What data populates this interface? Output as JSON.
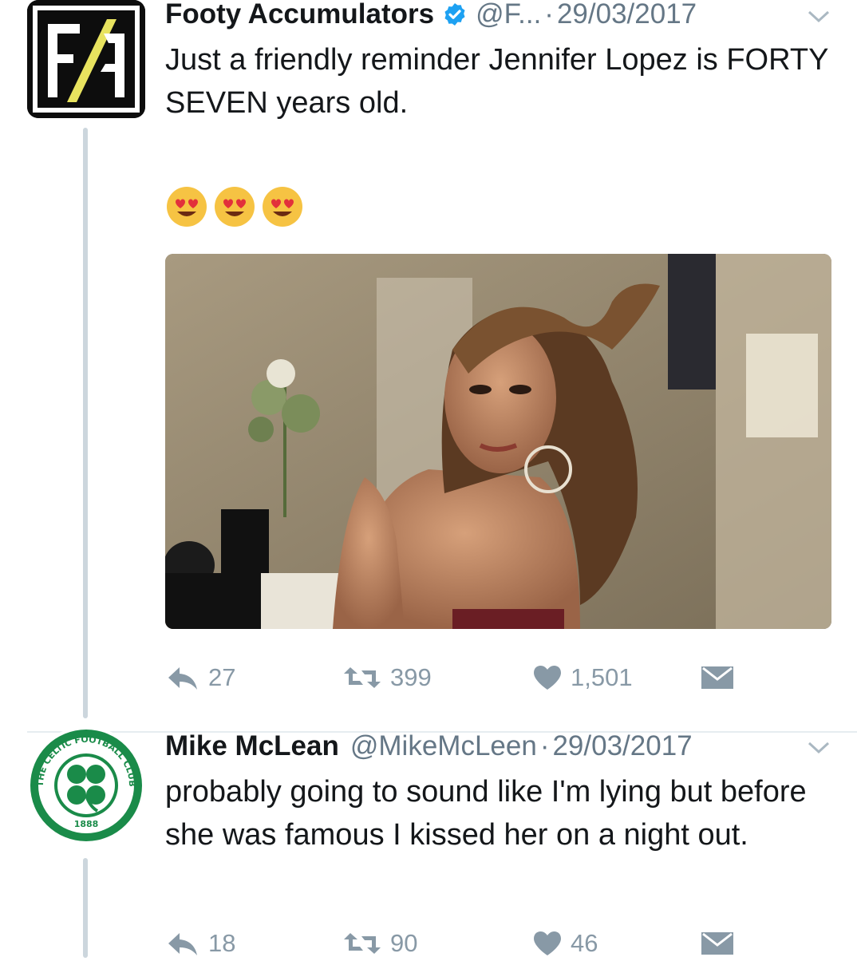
{
  "colors": {
    "name": "#14171a",
    "meta": "#657786",
    "icon": "#8899a6",
    "verified": "#1da1f2",
    "thread": "#ccd6dd",
    "fa_accent": "#e8e35f",
    "celtic_green": "#1a8b49"
  },
  "tweet1": {
    "avatar_text": "F/A",
    "name": "Footy Accumulators",
    "handle": "@F...",
    "separator": "·",
    "date": "29/03/2017",
    "text": "Just a friendly reminder Jennifer Lopez is FORTY SEVEN years old.",
    "emojis": [
      "😍",
      "😍",
      "😍"
    ],
    "media_icon": "photo-woman-icon",
    "replies": "27",
    "retweets": "399",
    "likes": "1,501"
  },
  "tweet2": {
    "avatar_top": "THE CELTIC FOOTBALL CLUB",
    "avatar_year": "1888",
    "name": "Mike McLean",
    "handle": "@MikeMcLeen",
    "separator": "·",
    "date": "29/03/2017",
    "text": "probably going to sound like I'm lying but before she was famous I kissed her on a night out.",
    "replies": "18",
    "retweets": "90",
    "likes": "46"
  }
}
